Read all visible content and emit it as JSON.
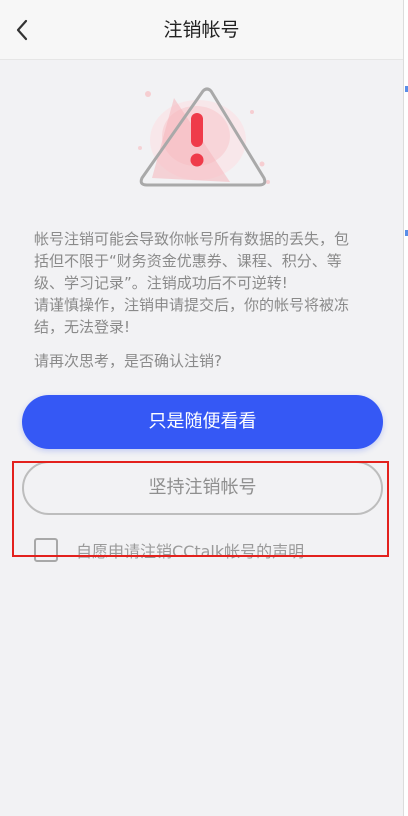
{
  "nav": {
    "title": "注销帐号",
    "back_icon": "chevron-left-icon"
  },
  "warning": {
    "icon": "warning-triangle-icon",
    "accent_color": "#f5aeb4",
    "lines": [
      "帐号注销可能会导致你帐号所有数据的丢失，包",
      "括但不限于“财务资金优惠券、课程、积分、等",
      "级、学习记录”。注销成功后不可逆转!",
      "请谨慎操作，注销申请提交后，你的帐号将被冻",
      "结，无法登录!"
    ],
    "confirm_question": "请再次思考，是否确认注销?"
  },
  "actions": {
    "primary_label": "只是随便看看",
    "primary_color": "#3558f5",
    "secondary_label": "坚持注销帐号"
  },
  "agreement": {
    "label": "自愿申请注销CCtalk帐号的声明",
    "checked": false
  },
  "highlight_color": "#e3211d"
}
